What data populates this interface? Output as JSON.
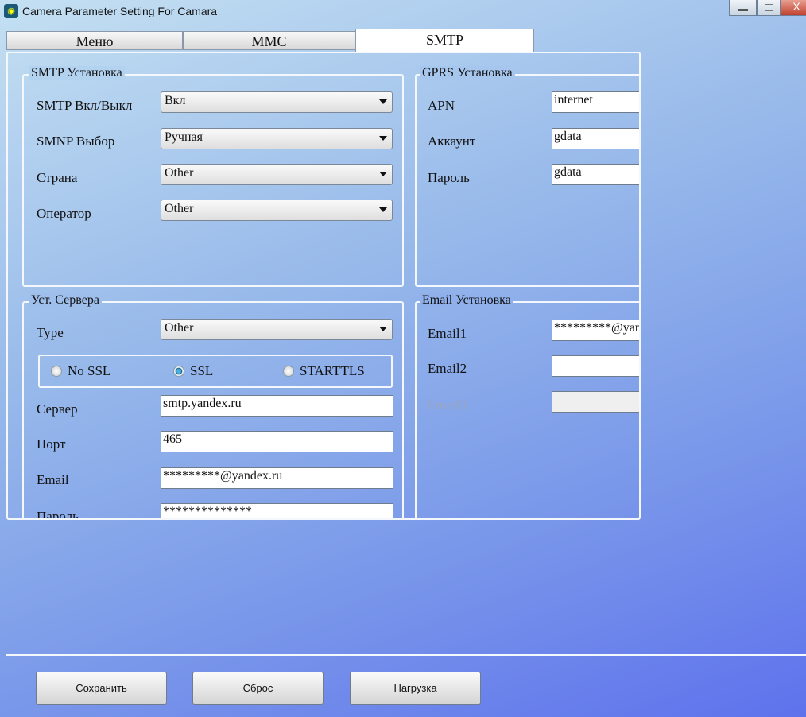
{
  "window": {
    "title": "Camera Parameter Setting For  Camara",
    "close": "X"
  },
  "tabs": [
    {
      "label": "Меню"
    },
    {
      "label": "MMC"
    },
    {
      "label": "SMTP",
      "active": true
    }
  ],
  "smtp_group": {
    "title": "SMTP Установка",
    "rows": [
      {
        "label": "SMTP Вкл/Выкл",
        "value": "Вкл"
      },
      {
        "label": "SMNP Выбор",
        "value": "Ручная"
      },
      {
        "label": "Страна",
        "value": "Other"
      },
      {
        "label": "Оператор",
        "value": "Other"
      }
    ]
  },
  "gprs_group": {
    "title": "GPRS Установка",
    "rows": [
      {
        "label": "APN",
        "value": "internet"
      },
      {
        "label": "Аккаунт",
        "value": "gdata"
      },
      {
        "label": "Пароль",
        "value": "gdata"
      }
    ]
  },
  "server_group": {
    "title": "Уст. Сервера",
    "type_label": "Type",
    "type_value": "Other",
    "ssl_options": [
      {
        "label": "No SSL",
        "checked": false
      },
      {
        "label": "SSL",
        "checked": true
      },
      {
        "label": "STARTTLS",
        "checked": false
      }
    ],
    "rows": [
      {
        "label": "Сервер",
        "value": "smtp.yandex.ru"
      },
      {
        "label": "Порт",
        "value": "465"
      },
      {
        "label": "Email",
        "value": "*********@yandex.ru"
      },
      {
        "label": "Пароль",
        "value": "**************"
      }
    ]
  },
  "email_group": {
    "title": "Email Установка",
    "rows": [
      {
        "label": "Email1",
        "value": "*********@yandex.ru",
        "disabled": false
      },
      {
        "label": "Email2",
        "value": "",
        "disabled": false
      },
      {
        "label": "Email3",
        "value": "",
        "disabled": true
      }
    ]
  },
  "buttons": {
    "save": "Сохранить",
    "reset": "Сброс",
    "load": "Нагрузка"
  },
  "colors": {
    "disabled_label": "#9aa6c0",
    "panel_border": "#f4f8fc"
  }
}
